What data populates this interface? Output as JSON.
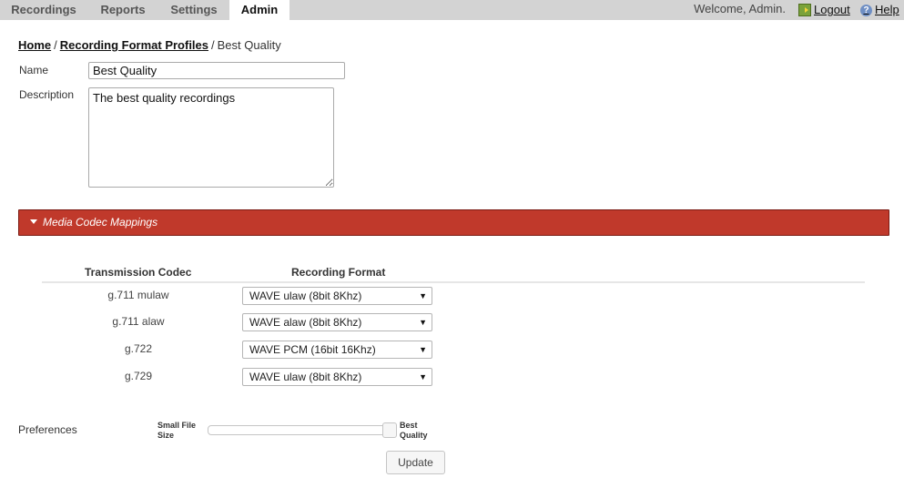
{
  "nav": {
    "tabs": [
      {
        "label": "Recordings",
        "active": false
      },
      {
        "label": "Reports",
        "active": false
      },
      {
        "label": "Settings",
        "active": false
      },
      {
        "label": "Admin",
        "active": true
      }
    ],
    "welcome": "Welcome, Admin.",
    "logout": "Logout",
    "help": "Help"
  },
  "breadcrumb": {
    "home": "Home",
    "section": "Recording Format Profiles",
    "separator": "/",
    "current": "Best Quality"
  },
  "form": {
    "name_label": "Name",
    "name_value": "Best Quality",
    "description_label": "Description",
    "description_value": "The best quality recordings"
  },
  "mappings": {
    "header": "Media Codec Mappings",
    "header_color": "#c0392b",
    "col_codec": "Transmission Codec",
    "col_format": "Recording Format",
    "rows": [
      {
        "codec": "g.711 mulaw",
        "format": "WAVE ulaw (8bit 8Khz)"
      },
      {
        "codec": "g.711 alaw",
        "format": "WAVE alaw (8bit 8Khz)"
      },
      {
        "codec": "g.722",
        "format": "WAVE PCM (16bit 16Khz)"
      },
      {
        "codec": "g.729",
        "format": "WAVE ulaw (8bit 8Khz)"
      }
    ]
  },
  "preferences": {
    "label": "Preferences",
    "min_label_1": "Small File",
    "min_label_2": "Size",
    "max_label_1": "Best",
    "max_label_2": "Quality",
    "slider_value": 1.0
  },
  "update_button": "Update"
}
